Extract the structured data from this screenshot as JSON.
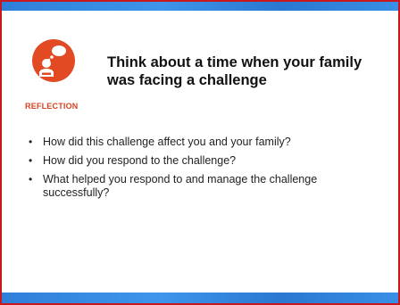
{
  "slide": {
    "badge": {
      "label": "REFLECTION",
      "icon": "person-thinking-icon",
      "color": "#e24a23"
    },
    "title": "Think about a time when your family was facing a challenge",
    "bullets": [
      "How did this challenge affect you and your family?",
      "How did you respond to the challenge?",
      "What helped you respond to and manage the challenge successfully?"
    ],
    "bullet_glyph": "•",
    "colors": {
      "border": "#c8181e",
      "bars": "#3a8fe6"
    }
  }
}
